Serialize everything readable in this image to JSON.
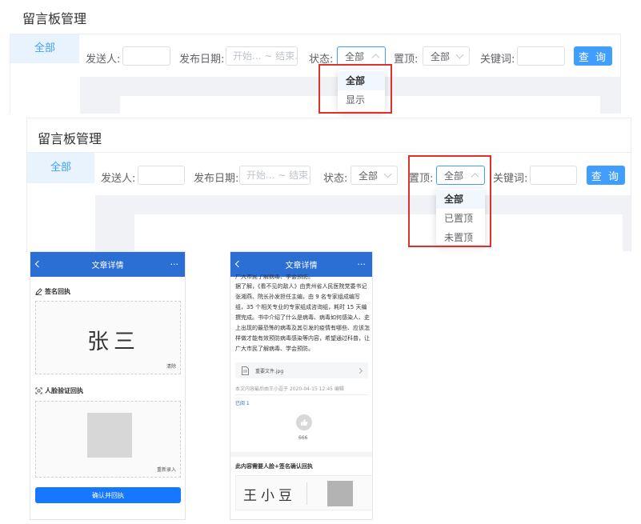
{
  "top_panel": {
    "title": "留言板管理",
    "side_tab": "全部",
    "filters": {
      "sender_label": "发送人:",
      "date_label": "发布日期:",
      "date_placeholder": "开始... ~ 结束...",
      "status_label": "状态:",
      "status_value": "全部",
      "pin_label": "置顶:",
      "pin_value": "全部",
      "keyword_label": "关键词:",
      "query_button": "查 询"
    },
    "status_dropdown": [
      "全部",
      "显示"
    ]
  },
  "bottom_panel": {
    "title": "留言板管理",
    "side_tab": "全部",
    "filters": {
      "sender_label": "发送人:",
      "date_label": "发布日期:",
      "date_placeholder": "开始... ~ 结束...",
      "status_label": "状态:",
      "status_value": "全部",
      "pin_label": "置顶:",
      "pin_value": "全部",
      "keyword_label": "关键词:",
      "query_button": "查 询"
    },
    "pin_dropdown": [
      "全部",
      "已置顶",
      "未置顶"
    ]
  },
  "phone_left": {
    "header_title": "文章详情",
    "more": "···",
    "signature_section": "签名回执",
    "signature_name": "张三",
    "clear_label": "清除",
    "face_section": "人脸验证回执",
    "re_record_label": "重新录入",
    "confirm_button": "确认并回执"
  },
  "phone_right": {
    "header_title": "文章详情",
    "more": "···",
    "article_lines": [
      "广大市民了解病毒、学会预防。",
      "据了解，《看不见的敌人》由贵州省人民医院党委书记",
      "张湘燕、院长孙发担任主编，由 9 名专家组成编写",
      "组，35 个相关专业的专家组成咨询组，耗时 15 天编",
      "撰完成。书中介绍了什么是病毒、病毒如何感染人、史",
      "上出现的最恐怖的病毒及其引发的疫情有哪些、应该怎",
      "样做才能有效预防病毒感染等内容，希望通过科普，让",
      "广大市民了解病毒、学会预防。"
    ],
    "file_name": "重要文件.jpg",
    "edit_note": "本文内容最后由王小逗于 2020-04-15 12:45 编辑",
    "read_label": "已阅  1",
    "like_count": "666",
    "receipt_title": "此内容需要人脸+签名确认回执",
    "signature_name": "王小豆"
  }
}
